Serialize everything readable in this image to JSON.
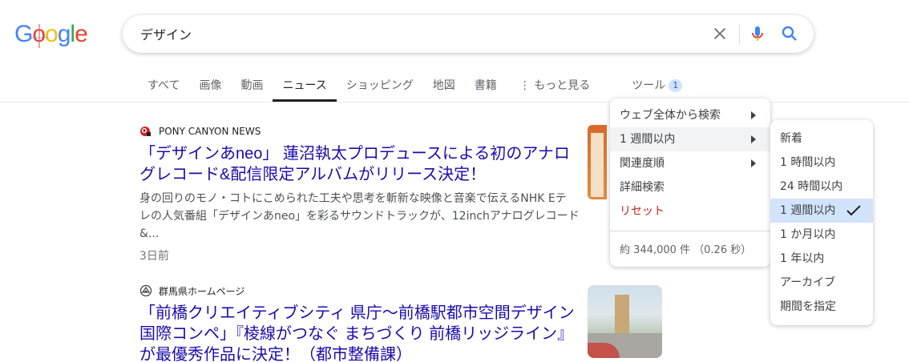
{
  "logo": {
    "g1": "G",
    "o1": "o",
    "o2": "o",
    "g2": "g",
    "l": "l",
    "e": "e"
  },
  "colors": {
    "blue": "#4285f4",
    "red": "#ea4335",
    "yellow": "#fbbc05",
    "green": "#34a853",
    "link": "#1a0dab"
  },
  "search": {
    "value": "デザイン"
  },
  "tabs": [
    {
      "label": "すべて"
    },
    {
      "label": "画像"
    },
    {
      "label": "動画"
    },
    {
      "label": "ニュース"
    },
    {
      "label": "ショッピング"
    },
    {
      "label": "地図"
    },
    {
      "label": "書籍"
    },
    {
      "label": "⋮ もっと見る"
    }
  ],
  "tools": {
    "label": "ツール",
    "badge": "1"
  },
  "results": [
    {
      "source": "PONY CANYON NEWS",
      "title_line1": "「デザインあneo」 蓮沼執太プロデュースによる初のアナロ",
      "title_line2": "グレコード&配信限定アルバムがリリース決定！",
      "snippet_line1": "身の回りのモノ・コトにこめられた工夫や思考を斬新な映像と音楽で伝えるNHK Eテ",
      "snippet_line2": "レの人気番組「デザインあneo」を彩るサウンドトラックが、12inchアナログレコード",
      "snippet_line3": "&...",
      "date": "3日前"
    },
    {
      "source": "群馬県ホームページ",
      "title_line1": "「前橋クリエイティブシティ 県庁～前橋駅都市空間デザイン",
      "title_line2": "国際コンペ」『棱線がつなぐ まちづくり 前橋リッジライン』",
      "title_line3": "が最優秀作品に決定！（都市整備課）"
    }
  ],
  "tools_menu": {
    "items": [
      {
        "label": "ウェブ全体から検索"
      },
      {
        "label": "1 週間以内"
      },
      {
        "label": "関連度順"
      },
      {
        "label": "詳細検索"
      },
      {
        "label": "リセット"
      }
    ],
    "result_count": "約 344,000 件 （0.26 秒）"
  },
  "time_menu": {
    "items": [
      {
        "label": "新着"
      },
      {
        "label": "1 時間以内"
      },
      {
        "label": "24 時間以内"
      },
      {
        "label": "1 週間以内"
      },
      {
        "label": "1 か月以内"
      },
      {
        "label": "1 年以内"
      },
      {
        "label": "アーカイブ"
      },
      {
        "label": "期間を指定"
      }
    ],
    "selected": "1 週間以内"
  }
}
